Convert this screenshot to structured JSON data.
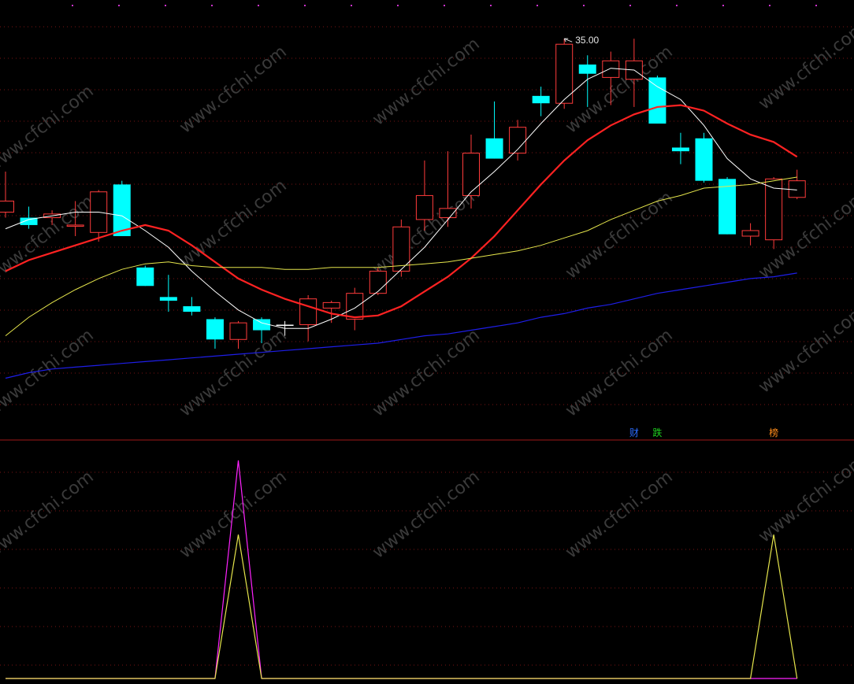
{
  "chart_data": [
    {
      "type": "candlestick",
      "panel": "price",
      "price_range": [
        15.0,
        36.5
      ],
      "candles": [
        {
          "o": 25.6,
          "h": 27.8,
          "l": 25.3,
          "c": 26.2,
          "color": "#ff3b3b"
        },
        {
          "o": 25.3,
          "h": 25.9,
          "l": 24.7,
          "c": 24.9,
          "color": "#00ffff"
        },
        {
          "o": 25.3,
          "h": 25.7,
          "l": 24.9,
          "c": 25.5,
          "color": "#ff3b3b"
        },
        {
          "o": 24.9,
          "h": 26.2,
          "l": 24.3,
          "c": 24.9,
          "color": "#ff3b3b"
        },
        {
          "o": 24.5,
          "h": 26.8,
          "l": 24.0,
          "c": 26.7,
          "color": "#ff3b3b"
        },
        {
          "o": 27.1,
          "h": 27.3,
          "l": 24.4,
          "c": 24.3,
          "color": "#00ffff"
        },
        {
          "o": 22.6,
          "h": 22.7,
          "l": 21.6,
          "c": 21.6,
          "color": "#00ffff"
        },
        {
          "o": 21.0,
          "h": 22.2,
          "l": 20.2,
          "c": 20.8,
          "color": "#00ffff"
        },
        {
          "o": 20.5,
          "h": 21.0,
          "l": 20.0,
          "c": 20.2,
          "color": "#00ffff"
        },
        {
          "o": 19.8,
          "h": 19.9,
          "l": 18.2,
          "c": 18.7,
          "color": "#00ffff"
        },
        {
          "o": 18.7,
          "h": 19.7,
          "l": 18.2,
          "c": 19.6,
          "color": "#ff3b3b"
        },
        {
          "o": 19.8,
          "h": 19.9,
          "l": 18.5,
          "c": 19.2,
          "color": "#00ffff"
        },
        {
          "o": 19.5,
          "h": 19.7,
          "l": 18.9,
          "c": 19.5,
          "color": "#ffffff"
        },
        {
          "o": 19.5,
          "h": 21.1,
          "l": 18.6,
          "c": 20.9,
          "color": "#ff3b3b"
        },
        {
          "o": 20.4,
          "h": 20.8,
          "l": 19.6,
          "c": 20.7,
          "color": "#ff3b3b"
        },
        {
          "o": 19.8,
          "h": 21.5,
          "l": 19.2,
          "c": 21.2,
          "color": "#ff3b3b"
        },
        {
          "o": 21.2,
          "h": 22.6,
          "l": 21.1,
          "c": 22.4,
          "color": "#ff3b3b"
        },
        {
          "o": 22.4,
          "h": 25.2,
          "l": 22.1,
          "c": 24.8,
          "color": "#ff3b3b"
        },
        {
          "o": 25.2,
          "h": 28.4,
          "l": 24.6,
          "c": 26.5,
          "color": "#ff3b3b"
        },
        {
          "o": 25.3,
          "h": 28.9,
          "l": 24.8,
          "c": 25.8,
          "color": "#ff3b3b"
        },
        {
          "o": 26.5,
          "h": 29.8,
          "l": 25.8,
          "c": 28.8,
          "color": "#ff3b3b"
        },
        {
          "o": 29.6,
          "h": 31.6,
          "l": 28.5,
          "c": 28.5,
          "color": "#00ffff"
        },
        {
          "o": 28.8,
          "h": 30.6,
          "l": 28.4,
          "c": 30.2,
          "color": "#ff3b3b"
        },
        {
          "o": 31.9,
          "h": 32.4,
          "l": 30.8,
          "c": 31.5,
          "color": "#00ffff"
        },
        {
          "o": 31.5,
          "h": 35.0,
          "l": 31.2,
          "c": 34.7,
          "color": "#ff3b3b"
        },
        {
          "o": 33.6,
          "h": 34.1,
          "l": 31.3,
          "c": 33.1,
          "color": "#00ffff"
        },
        {
          "o": 32.9,
          "h": 34.3,
          "l": 31.4,
          "c": 33.8,
          "color": "#ff3b3b"
        },
        {
          "o": 32.8,
          "h": 35.0,
          "l": 31.3,
          "c": 33.8,
          "color": "#ff3b3b"
        },
        {
          "o": 32.9,
          "h": 33.0,
          "l": 30.4,
          "c": 30.4,
          "color": "#00ffff"
        },
        {
          "o": 29.1,
          "h": 29.9,
          "l": 28.2,
          "c": 28.9,
          "color": "#00ffff"
        },
        {
          "o": 29.6,
          "h": 29.9,
          "l": 27.2,
          "c": 27.3,
          "color": "#00ffff"
        },
        {
          "o": 27.4,
          "h": 27.5,
          "l": 24.4,
          "c": 24.4,
          "color": "#00ffff"
        },
        {
          "o": 24.3,
          "h": 25.0,
          "l": 23.8,
          "c": 24.6,
          "color": "#ff3b3b"
        },
        {
          "o": 24.1,
          "h": 27.5,
          "l": 23.6,
          "c": 27.4,
          "color": "#ff3b3b"
        },
        {
          "o": 26.4,
          "h": 27.9,
          "l": 26.3,
          "c": 27.3,
          "color": "#ff3b3b"
        }
      ],
      "moving_averages": [
        {
          "color": "#ffffff",
          "width": 1,
          "values": [
            24.7,
            25.2,
            25.4,
            25.6,
            25.6,
            25.4,
            24.6,
            23.7,
            22.4,
            21.3,
            20.3,
            19.6,
            19.3,
            19.3,
            19.8,
            20.4,
            21.3,
            22.5,
            23.7,
            25.2,
            26.7,
            27.8,
            29.0,
            30.4,
            31.7,
            32.8,
            33.4,
            33.3,
            32.4,
            31.7,
            30.3,
            28.5,
            27.4,
            26.9,
            26.8
          ]
        },
        {
          "color": "#ff2222",
          "width": 2.2,
          "values": [
            22.4,
            23.0,
            23.4,
            23.8,
            24.2,
            24.6,
            24.9,
            24.6,
            23.8,
            22.9,
            22.0,
            21.4,
            20.9,
            20.5,
            20.1,
            19.9,
            20.0,
            20.5,
            21.3,
            22.1,
            23.1,
            24.3,
            25.7,
            27.1,
            28.4,
            29.5,
            30.3,
            30.9,
            31.3,
            31.4,
            31.1,
            30.4,
            29.8,
            29.4,
            28.6
          ]
        },
        {
          "color": "#e6e64c",
          "width": 1,
          "values": [
            18.9,
            19.9,
            20.7,
            21.4,
            22.0,
            22.5,
            22.8,
            22.9,
            22.7,
            22.6,
            22.6,
            22.6,
            22.5,
            22.5,
            22.6,
            22.6,
            22.6,
            22.7,
            22.8,
            22.9,
            23.1,
            23.3,
            23.5,
            23.8,
            24.2,
            24.6,
            25.2,
            25.7,
            26.2,
            26.5,
            26.9,
            27.0,
            27.1,
            27.3,
            27.5
          ]
        },
        {
          "color": "#1e1ee8",
          "width": 1.2,
          "values": [
            16.6,
            16.9,
            17.1,
            17.2,
            17.3,
            17.4,
            17.5,
            17.6,
            17.7,
            17.8,
            17.9,
            18.0,
            18.1,
            18.2,
            18.3,
            18.4,
            18.5,
            18.7,
            18.9,
            19.0,
            19.2,
            19.4,
            19.6,
            19.9,
            20.1,
            20.4,
            20.6,
            20.9,
            21.2,
            21.4,
            21.6,
            21.8,
            22.0,
            22.1,
            22.3
          ]
        }
      ],
      "annotations": [
        {
          "text": "35.00"
        }
      ]
    },
    {
      "type": "line",
      "panel": "indicator",
      "ylim": [
        0,
        100
      ],
      "series": [
        {
          "color": "#ff22ff",
          "values": [
            0,
            0,
            0,
            0,
            0,
            0,
            0,
            0,
            0,
            0,
            100,
            0,
            0,
            0,
            0,
            0,
            0,
            0,
            0,
            0,
            0,
            0,
            0,
            0,
            0,
            0,
            0,
            0,
            0,
            0,
            0,
            0,
            0,
            0,
            0
          ]
        },
        {
          "color": "#e6e64c",
          "values": [
            0,
            0,
            0,
            0,
            0,
            0,
            0,
            0,
            0,
            0,
            66,
            0,
            0,
            0,
            0,
            0,
            0,
            0,
            0,
            0,
            0,
            0,
            0,
            0,
            0,
            0,
            0,
            0,
            0,
            0,
            0,
            0,
            0,
            66,
            0
          ]
        }
      ]
    }
  ],
  "event_tags": [
    {
      "text": "财",
      "color": "#2b6cff",
      "index": 27
    },
    {
      "text": "跌",
      "color": "#1fd21f",
      "index": 28
    },
    {
      "text": "榜",
      "color": "#ff8c1a",
      "index": 33
    }
  ],
  "watermark": "www.cfchi.com"
}
